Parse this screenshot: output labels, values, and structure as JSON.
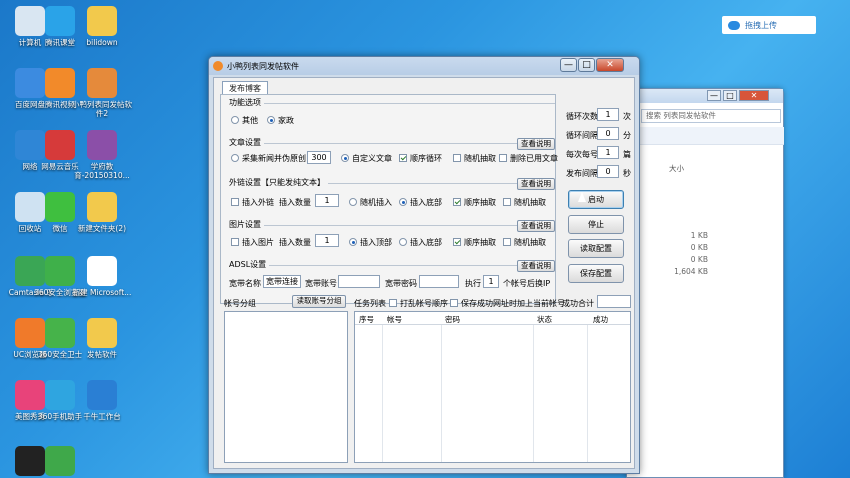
{
  "desktop": {
    "icons": [
      {
        "label": "计算机",
        "color": "#d9e6f2"
      },
      {
        "label": "腾讯课堂",
        "color": "#2aa3e8"
      },
      {
        "label": "bilidown",
        "color": "#f2c94c"
      },
      {
        "label": "百度网盘",
        "color": "#3c8be0"
      },
      {
        "label": "腾讯视频",
        "color": "#f28a2a"
      },
      {
        "label": "小鸭列表同发帖软件2",
        "color": "#e58a3b"
      },
      {
        "label": "网络",
        "color": "#2f86d6"
      },
      {
        "label": "网易云音乐",
        "color": "#d63a3a"
      },
      {
        "label": "学府教育-20150310...",
        "color": "#8b4fa8"
      },
      {
        "label": "回收站",
        "color": "#cfe2f2"
      },
      {
        "label": "微信",
        "color": "#3fbf3f"
      },
      {
        "label": "新建文件夹(2)",
        "color": "#f2c94c"
      },
      {
        "label": "Camtasia 9",
        "color": "#3aa655"
      },
      {
        "label": "360安全浏览器",
        "color": "#3fb04a"
      },
      {
        "label": "新建 Microsoft...",
        "color": "#ffffff"
      },
      {
        "label": "UC浏览器",
        "color": "#f07a2a"
      },
      {
        "label": "360安全卫士",
        "color": "#46b34a"
      },
      {
        "label": "发帖软件",
        "color": "#f2c94c"
      },
      {
        "label": "美图秀秀",
        "color": "#e8437a"
      },
      {
        "label": "360手机助手",
        "color": "#2fa5e0"
      },
      {
        "label": "千牛工作台",
        "color": "#2a7fd4"
      },
      {
        "label": "",
        "color": "#222222"
      },
      {
        "label": "",
        "color": "#3fa84a"
      }
    ]
  },
  "cloud_widget": {
    "label": "拖拽上传"
  },
  "explorer": {
    "search_placeholder": "搜索 列表同发帖软件",
    "column_size": "大小",
    "sizes": [
      "1 KB",
      "0 KB",
      "0 KB",
      "1,604 KB"
    ],
    "ctrl_min": "—",
    "ctrl_max": "□",
    "ctrl_close": "✕"
  },
  "window": {
    "title": "小鸭列表同发帖软件",
    "min": "—",
    "max": "□",
    "close": "✕",
    "tab": "发布博客",
    "function": {
      "title": "功能选项",
      "opt_other": "其他",
      "opt_home": "家政"
    },
    "article": {
      "title": "文章设置",
      "help": "查看说明",
      "collect_label": "采集新闻并伪原创",
      "collect_count": "300",
      "custom_label": "自定义文章",
      "loop_label": "顺序循环",
      "random_label": "随机抽取",
      "delete_used": "删除已用文章"
    },
    "outlink": {
      "title": "外链设置【只能发纯文本】",
      "help": "查看说明",
      "insert_link": "插入外链",
      "count_label": "插入数量",
      "count": "1",
      "random_insert": "随机插入",
      "insert_bottom": "插入底部",
      "seq_pick": "顺序抽取",
      "random_pick": "随机抽取"
    },
    "image": {
      "title": "图片设置",
      "help": "查看说明",
      "insert_image": "插入图片",
      "count_label": "插入数量",
      "count": "1",
      "insert_top": "插入顶部",
      "insert_bottom": "插入底部",
      "seq_pick": "顺序抽取",
      "random_pick": "随机抽取"
    },
    "adsl": {
      "title": "ADSL设置",
      "help": "查看说明",
      "bb_name": "宽带名称",
      "bb_name_value": "宽带连接",
      "bb_account": "宽带账号",
      "bb_password": "宽带密码",
      "exec": "执行",
      "exec_value": "1",
      "after_ip": "个帐号后换IP"
    },
    "right": {
      "loop_count_label": "循环次数",
      "loop_count": "1",
      "loop_count_unit": "次",
      "loop_interval_label": "循环间隔",
      "loop_interval": "0",
      "loop_interval_unit": "分",
      "per_account_label": "每次每号",
      "per_account": "1",
      "per_account_unit": "篇",
      "post_interval_label": "发布间隔",
      "post_interval": "0",
      "post_interval_unit": "秒",
      "start": "启动",
      "stop": "停止",
      "read_config": "读取配置",
      "save_config": "保存配置"
    },
    "account": {
      "group_label": "帐号分组",
      "read_group": "读取账号分组"
    },
    "task": {
      "label": "任务列表",
      "shuffle": "打乱帐号顺序",
      "save_success": "保存成功网址时加上当前帐号",
      "success_total": "成功合计",
      "columns": [
        "序号",
        "帐号",
        "密码",
        "状态",
        "成功"
      ]
    }
  }
}
